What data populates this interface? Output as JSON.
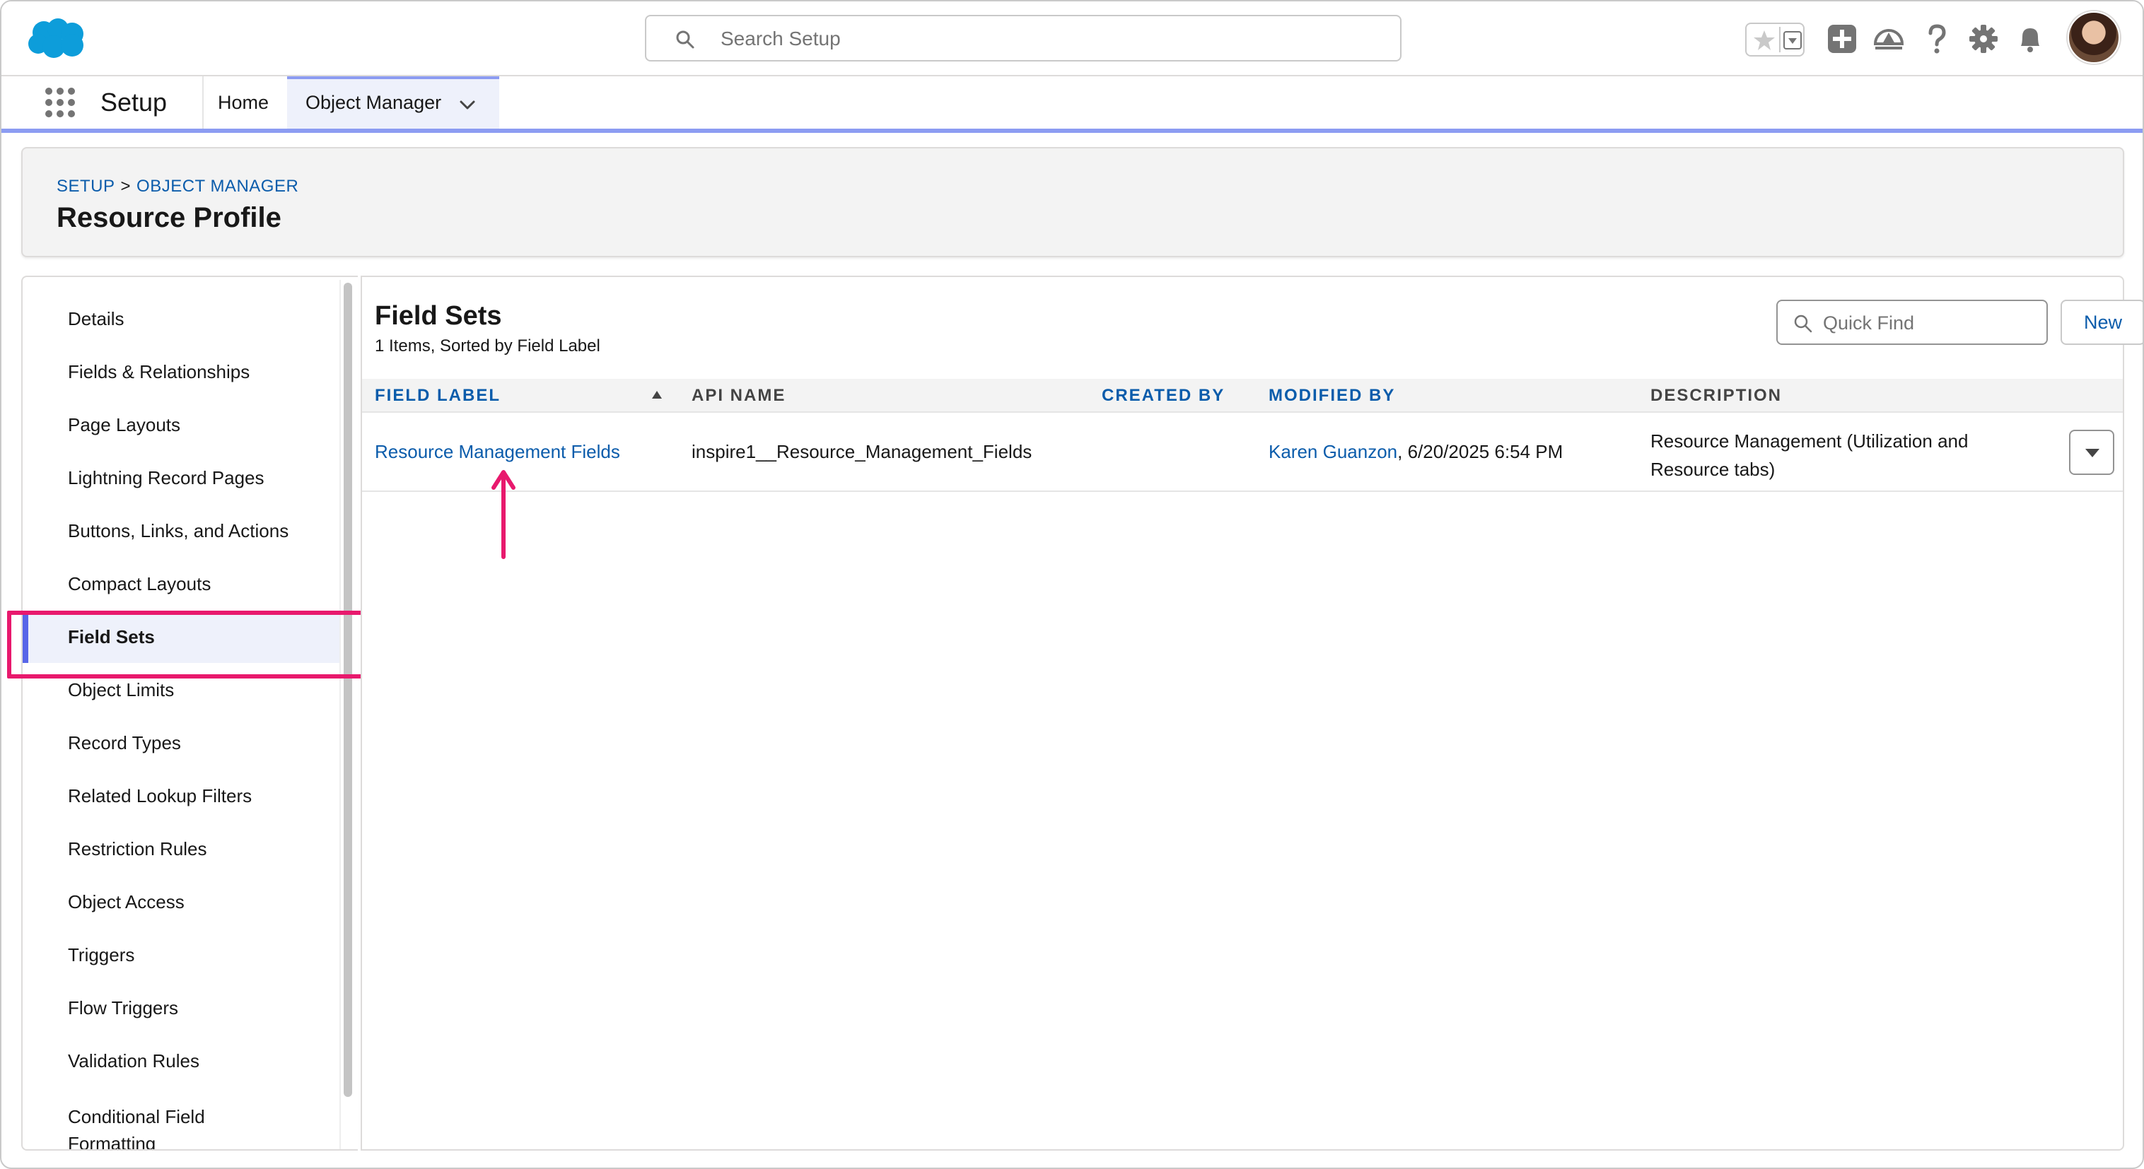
{
  "header": {
    "search_placeholder": "Search Setup"
  },
  "app_nav": {
    "app_name": "Setup",
    "tabs": [
      {
        "label": "Home"
      },
      {
        "label": "Object Manager"
      }
    ]
  },
  "page_header": {
    "breadcrumb": [
      "SETUP",
      ">",
      "OBJECT MANAGER"
    ],
    "title": "Resource Profile"
  },
  "sidebar": {
    "items": [
      {
        "label": "Details"
      },
      {
        "label": "Fields & Relationships"
      },
      {
        "label": "Page Layouts"
      },
      {
        "label": "Lightning Record Pages"
      },
      {
        "label": "Buttons, Links, and Actions"
      },
      {
        "label": "Compact Layouts"
      },
      {
        "label": "Field Sets"
      },
      {
        "label": "Object Limits"
      },
      {
        "label": "Record Types"
      },
      {
        "label": "Related Lookup Filters"
      },
      {
        "label": "Restriction Rules"
      },
      {
        "label": "Object Access"
      },
      {
        "label": "Triggers"
      },
      {
        "label": "Flow Triggers"
      },
      {
        "label": "Validation Rules"
      },
      {
        "label": "Conditional Field Formatting"
      }
    ],
    "active_index": 6
  },
  "main": {
    "title": "Field Sets",
    "subtitle": "1 Items, Sorted by Field Label",
    "quick_find_placeholder": "Quick Find",
    "new_label": "New",
    "columns": [
      "FIELD LABEL",
      "API NAME",
      "CREATED BY",
      "MODIFIED BY",
      "DESCRIPTION"
    ],
    "rows": [
      {
        "field_label": "Resource Management Fields",
        "api_name": "inspire1__Resource_Management_Fields",
        "created_by": "",
        "modified_by_user": "Karen Guanzon",
        "modified_by_date": ", 6/20/2025 6:54 PM",
        "description_line1": "Resource Management (Utilization and",
        "description_line2": "Resource tabs)"
      }
    ]
  },
  "colors": {
    "brand_blue": "#0b5cab",
    "nav_accent": "#8c9cf2",
    "active_bar": "#5867e8",
    "annotation": "#e8196d"
  }
}
